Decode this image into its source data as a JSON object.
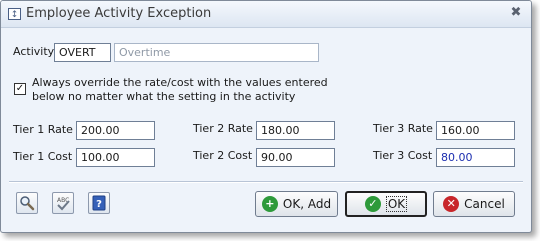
{
  "window": {
    "title": "Employee Activity Exception"
  },
  "activity": {
    "label": "Activity",
    "code": "OVERT",
    "description": "Overtime"
  },
  "override": {
    "checked": true,
    "text_line1": "Always override the rate/cost with the values entered",
    "text_line2": "below no matter what the setting in the activity"
  },
  "tiers": {
    "tier1_rate_label": "Tier 1 Rate",
    "tier1_rate": "200.00",
    "tier2_rate_label": "Tier 2 Rate",
    "tier2_rate": "180.00",
    "tier3_rate_label": "Tier 3 Rate",
    "tier3_rate": "160.00",
    "tier1_cost_label": "Tier 1 Cost",
    "tier1_cost": "100.00",
    "tier2_cost_label": "Tier 2 Cost",
    "tier2_cost": "90.00",
    "tier3_cost_label": "Tier 3 Cost",
    "tier3_cost": "80.00"
  },
  "toolbar": {
    "search_icon": "magnifier-icon",
    "spellcheck_icon": "spellcheck-icon",
    "help_icon": "help-icon"
  },
  "buttons": {
    "ok_add_label": "OK, Add",
    "ok_label": "OK",
    "cancel_label": "Cancel"
  },
  "colors": {
    "ok_add_green": "#2e9a3a",
    "ok_green": "#2e9a3a",
    "cancel_red": "#c8262a",
    "tier3_cost_text": "#1d2fb0"
  }
}
